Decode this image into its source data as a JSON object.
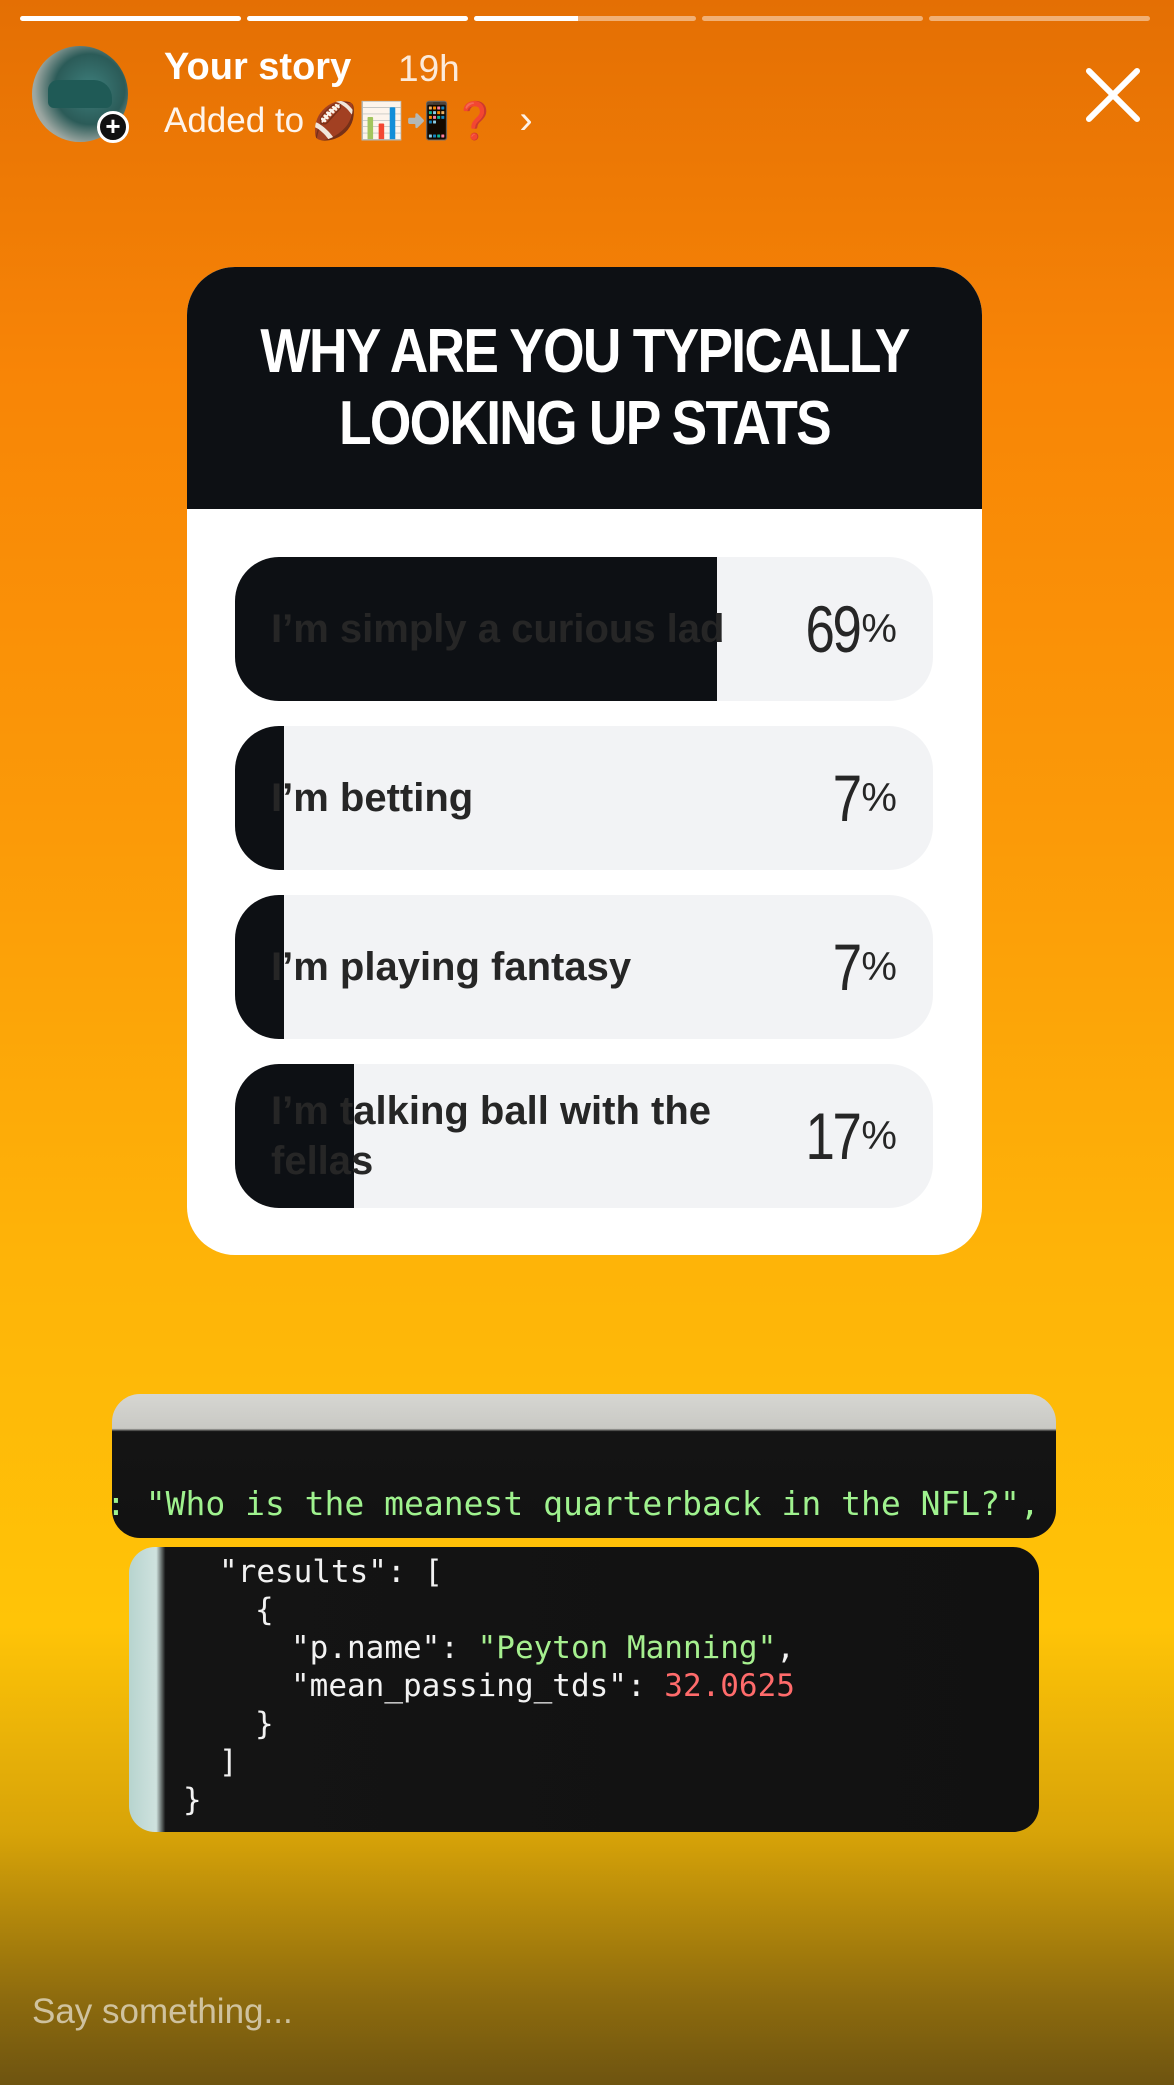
{
  "progress": {
    "segments": [
      1.0,
      1.0,
      0.47,
      0.0,
      0.0
    ]
  },
  "header": {
    "title": "Your story",
    "time": "19h",
    "added_prefix": "Added to",
    "highlight_emojis": "🏈📊📲❓",
    "close_icon": "close-icon"
  },
  "poll": {
    "question": "WHY ARE YOU TYPICALLY LOOKING UP STATS",
    "options": [
      {
        "label": "I’m simply a curious lad",
        "percent": 69,
        "percent_text": "69"
      },
      {
        "label": "I’m betting",
        "percent": 7,
        "percent_text": "7"
      },
      {
        "label": "I’m playing fantasy",
        "percent": 7,
        "percent_text": "7"
      },
      {
        "label": "I’m talking ball with the fellas",
        "percent": 17,
        "percent_text": "17"
      }
    ],
    "percent_symbol": "%"
  },
  "code_screens": {
    "query_line": ": \"Who is the meanest quarterback in the NFL?\",",
    "results_key": "\"results\": [",
    "open_brace": "{",
    "name_key": "\"p.name\": ",
    "name_value": "\"Peyton Manning\"",
    "tds_key": "\"mean_passing_tds\": ",
    "tds_value": "32.0625",
    "close_brace": "}",
    "close_bracket": "]",
    "close_outer": "}"
  },
  "reply": {
    "placeholder": "Say something..."
  },
  "colors": {
    "bar_dark": "#0d1014",
    "option_bg": "#f2f3f5",
    "code_green": "#a6f08f",
    "code_red": "#ff6b6b"
  }
}
